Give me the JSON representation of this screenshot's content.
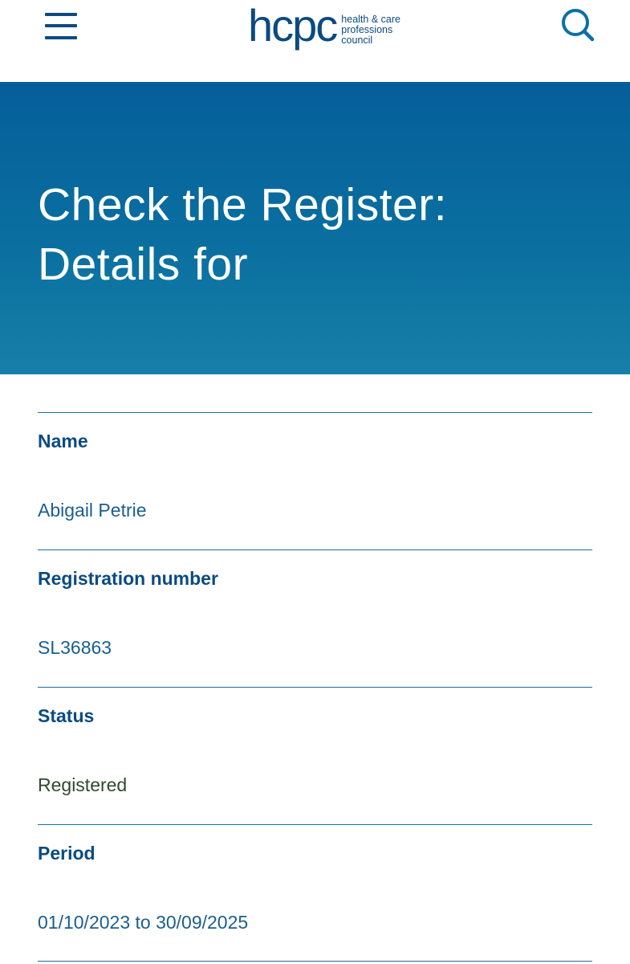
{
  "header": {
    "logo": {
      "wordmark": "hcpc",
      "line1": "health & care",
      "line2": "professions",
      "line3": "council"
    },
    "menu_icon": "hamburger-menu-icon",
    "search_icon": "search-icon"
  },
  "hero": {
    "title": "Check the Register: Details for"
  },
  "details": [
    {
      "label": "Name",
      "value": "Abigail Petrie"
    },
    {
      "label": "Registration number",
      "value": "SL36863"
    },
    {
      "label": "Status",
      "value": "Registered"
    },
    {
      "label": "Period",
      "value": "01/10/2023 to 30/09/2025"
    }
  ],
  "colors": {
    "brand_blue": "#0a4b80",
    "hero_top": "#065e9a",
    "hero_bottom": "#177fa8",
    "divider": "#1a6f9c",
    "status_text": "#2e4a2e"
  }
}
